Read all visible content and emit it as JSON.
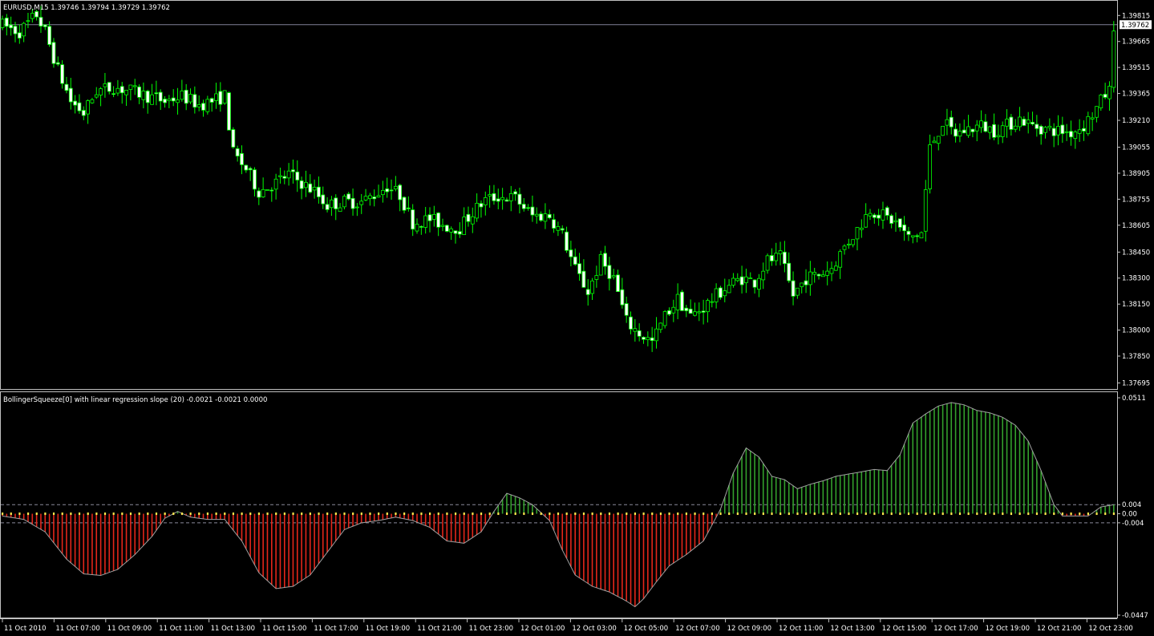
{
  "header": {
    "symbol_info": "EURUSD,M15  1.39746 1.39794 1.39729 1.39762",
    "indicator_info": "BollingerSqueeze[0] with linear regression slope (20) -0.0021 -0.0021 0.0000"
  },
  "colors": {
    "background": "#000000",
    "frame": "#c0c0c0",
    "candle": "#00ff00",
    "bull_body": "#000000",
    "bear_body": "#ffffff",
    "hist_positive": "#33a02c",
    "hist_negative": "#e3261a",
    "slope_line": "#a0a0a0",
    "squeeze_dot": "#ffe84d",
    "price_line": "#808098"
  },
  "chart_data": [
    {
      "type": "candlestick",
      "title": "EURUSD,M15",
      "ohlc_header": [
        1.39746,
        1.39794,
        1.39729,
        1.39762
      ],
      "y_ticks": [
        "1.39815",
        "1.39665",
        "1.39515",
        "1.39365",
        "1.39210",
        "1.39055",
        "1.38905",
        "1.38755",
        "1.38605",
        "1.38450",
        "1.38300",
        "1.38150",
        "1.38000",
        "1.37850",
        "1.37695"
      ],
      "ylim": [
        1.37665,
        1.39895
      ],
      "current_price": "1.39762",
      "anchors": [
        [
          0,
          1.3976
        ],
        [
          4,
          1.3972
        ],
        [
          8,
          1.3982
        ],
        [
          10,
          1.3972
        ],
        [
          13,
          1.395
        ],
        [
          16,
          1.3932
        ],
        [
          19,
          1.3925
        ],
        [
          22,
          1.3938
        ],
        [
          26,
          1.394
        ],
        [
          30,
          1.3938
        ],
        [
          34,
          1.3935
        ],
        [
          38,
          1.3932
        ],
        [
          42,
          1.3935
        ],
        [
          46,
          1.393
        ],
        [
          49,
          1.3932
        ],
        [
          52,
          1.3935
        ],
        [
          54,
          1.3902
        ],
        [
          57,
          1.3893
        ],
        [
          60,
          1.388
        ],
        [
          64,
          1.3885
        ],
        [
          67,
          1.389
        ],
        [
          70,
          1.3885
        ],
        [
          73,
          1.388
        ],
        [
          76,
          1.3872
        ],
        [
          80,
          1.3874
        ],
        [
          84,
          1.3874
        ],
        [
          87,
          1.3878
        ],
        [
          90,
          1.3883
        ],
        [
          93,
          1.3878
        ],
        [
          96,
          1.3862
        ],
        [
          100,
          1.3864
        ],
        [
          104,
          1.386
        ],
        [
          107,
          1.3859
        ],
        [
          110,
          1.3868
        ],
        [
          113,
          1.3875
        ],
        [
          116,
          1.3877
        ],
        [
          120,
          1.3876
        ],
        [
          124,
          1.3866
        ],
        [
          128,
          1.3866
        ],
        [
          131,
          1.3855
        ],
        [
          134,
          1.3835
        ],
        [
          137,
          1.3822
        ],
        [
          140,
          1.384
        ],
        [
          143,
          1.383
        ],
        [
          146,
          1.3805
        ],
        [
          149,
          1.3798
        ],
        [
          152,
          1.3793
        ],
        [
          155,
          1.3808
        ],
        [
          158,
          1.3818
        ],
        [
          161,
          1.3808
        ],
        [
          164,
          1.3813
        ],
        [
          167,
          1.382
        ],
        [
          170,
          1.3826
        ],
        [
          173,
          1.383
        ],
        [
          176,
          1.3828
        ],
        [
          179,
          1.384
        ],
        [
          182,
          1.3842
        ],
        [
          185,
          1.382
        ],
        [
          188,
          1.383
        ],
        [
          191,
          1.3832
        ],
        [
          194,
          1.3836
        ],
        [
          197,
          1.3848
        ],
        [
          200,
          1.3858
        ],
        [
          203,
          1.387
        ],
        [
          206,
          1.3866
        ],
        [
          209,
          1.3862
        ],
        [
          212,
          1.3853
        ],
        [
          215,
          1.3856
        ],
        [
          217,
          1.3905
        ],
        [
          220,
          1.392
        ],
        [
          223,
          1.3913
        ],
        [
          226,
          1.3916
        ],
        [
          229,
          1.3918
        ],
        [
          232,
          1.3915
        ],
        [
          235,
          1.3918
        ],
        [
          238,
          1.3922
        ],
        [
          241,
          1.3918
        ],
        [
          244,
          1.3916
        ],
        [
          247,
          1.3915
        ],
        [
          250,
          1.3914
        ],
        [
          253,
          1.3918
        ],
        [
          256,
          1.3928
        ],
        [
          258,
          1.3936
        ],
        [
          259,
          1.3938
        ],
        [
          260,
          1.39762
        ]
      ]
    },
    {
      "type": "bar",
      "title": "BollingerSqueeze[0] with linear regression slope (20)",
      "header_values": [
        "-0.0021",
        "-0.0021",
        "0.0000"
      ],
      "y_ticks": [
        "0.0511",
        "0.004",
        "0.00",
        "-0.004",
        "-0.0447"
      ],
      "ylim": [
        -0.0447,
        0.0511
      ],
      "slope_anchors": [
        [
          0,
          -0.001
        ],
        [
          5,
          -0.0025
        ],
        [
          10,
          -0.008
        ],
        [
          15,
          -0.02
        ],
        [
          19,
          -0.0265
        ],
        [
          23,
          -0.0272
        ],
        [
          27,
          -0.0245
        ],
        [
          31,
          -0.018
        ],
        [
          35,
          -0.01
        ],
        [
          38,
          -0.002
        ],
        [
          41,
          0.001
        ],
        [
          44,
          -0.0015
        ],
        [
          48,
          -0.0025
        ],
        [
          52,
          -0.0025
        ],
        [
          56,
          -0.012
        ],
        [
          60,
          -0.026
        ],
        [
          64,
          -0.033
        ],
        [
          68,
          -0.032
        ],
        [
          72,
          -0.027
        ],
        [
          76,
          -0.017
        ],
        [
          80,
          -0.007
        ],
        [
          84,
          -0.004
        ],
        [
          88,
          -0.003
        ],
        [
          92,
          -0.0015
        ],
        [
          96,
          -0.003
        ],
        [
          100,
          -0.006
        ],
        [
          104,
          -0.012
        ],
        [
          108,
          -0.013
        ],
        [
          112,
          -0.008
        ],
        [
          115,
          0.001
        ],
        [
          118,
          0.009
        ],
        [
          121,
          0.007
        ],
        [
          124,
          0.004
        ],
        [
          128,
          -0.003
        ],
        [
          131,
          -0.016
        ],
        [
          134,
          -0.027
        ],
        [
          138,
          -0.032
        ],
        [
          142,
          -0.0345
        ],
        [
          146,
          -0.0385
        ],
        [
          148,
          -0.041
        ],
        [
          150,
          -0.0375
        ],
        [
          153,
          -0.03
        ],
        [
          156,
          -0.023
        ],
        [
          160,
          -0.018
        ],
        [
          164,
          -0.012
        ],
        [
          168,
          0.002
        ],
        [
          171,
          0.018
        ],
        [
          174,
          0.029
        ],
        [
          177,
          0.025
        ],
        [
          180,
          0.0165
        ],
        [
          183,
          0.015
        ],
        [
          186,
          0.011
        ],
        [
          189,
          0.013
        ],
        [
          192,
          0.0145
        ],
        [
          195,
          0.0165
        ],
        [
          198,
          0.0175
        ],
        [
          201,
          0.0185
        ],
        [
          204,
          0.0195
        ],
        [
          207,
          0.019
        ],
        [
          210,
          0.026
        ],
        [
          213,
          0.04
        ],
        [
          216,
          0.044
        ],
        [
          219,
          0.0475
        ],
        [
          222,
          0.049
        ],
        [
          225,
          0.048
        ],
        [
          228,
          0.0455
        ],
        [
          231,
          0.0445
        ],
        [
          234,
          0.0425
        ],
        [
          237,
          0.039
        ],
        [
          240,
          0.032
        ],
        [
          243,
          0.019
        ],
        [
          246,
          0.004
        ],
        [
          248,
          -0.001
        ],
        [
          251,
          -0.001
        ],
        [
          254,
          -0.001
        ],
        [
          257,
          0.003
        ],
        [
          260,
          0.004
        ]
      ]
    }
  ],
  "x_axis": {
    "labels": [
      "11 Oct 2010",
      "11 Oct 07:00",
      "11 Oct 09:00",
      "11 Oct 11:00",
      "11 Oct 13:00",
      "11 Oct 15:00",
      "11 Oct 17:00",
      "11 Oct 19:00",
      "11 Oct 21:00",
      "11 Oct 23:00",
      "12 Oct 01:00",
      "12 Oct 03:00",
      "12 Oct 05:00",
      "12 Oct 07:00",
      "12 Oct 09:00",
      "12 Oct 11:00",
      "12 Oct 13:00",
      "12 Oct 15:00",
      "12 Oct 17:00",
      "12 Oct 19:00",
      "12 Oct 21:00",
      "12 Oct 23:00"
    ]
  }
}
